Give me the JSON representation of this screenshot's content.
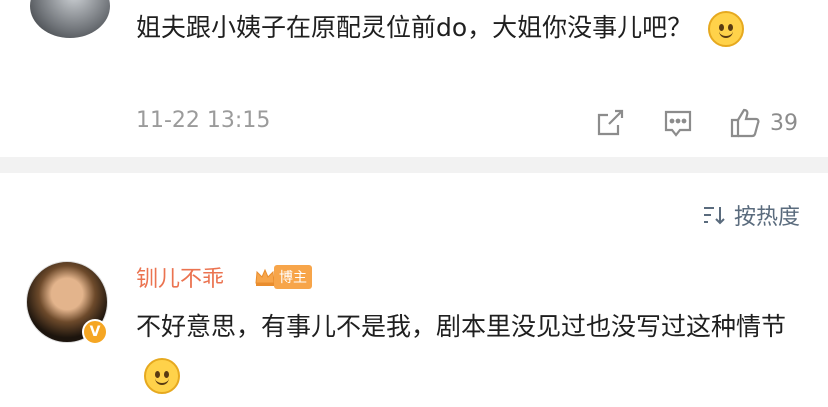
{
  "top_comment": {
    "text": "姐夫跟小姨子在原配灵位前do，大姐你没事儿吧？",
    "emoji": "emoji",
    "time": "11-22 13:15",
    "likes": "39"
  },
  "sort": {
    "label": "按热度"
  },
  "reply": {
    "username": "钏儿不乖",
    "badge": "博主",
    "text": "不好意思，有事儿不是我，剧本里没见过也没写过这种情节",
    "emoji": "emoji"
  },
  "colors": {
    "username": "#eb7350",
    "badge": "#f7a54a",
    "divider": "#f2f2f2",
    "muted": "#9b9b9b"
  }
}
